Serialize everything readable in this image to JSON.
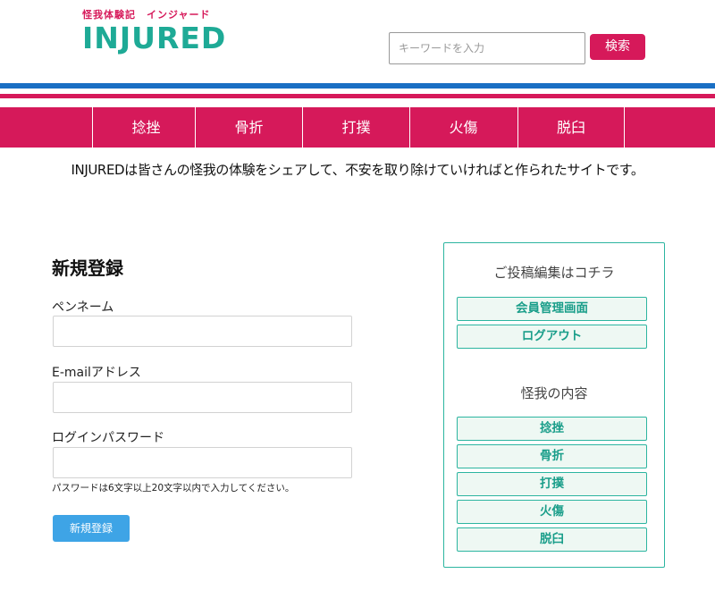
{
  "header": {
    "logo_sub": "怪我体験記　インジャード",
    "logo_main": "INJURED",
    "search_placeholder": "キーワードを入力",
    "search_button": "検索"
  },
  "nav": {
    "items": [
      {
        "label": "捻挫"
      },
      {
        "label": "骨折"
      },
      {
        "label": "打撲"
      },
      {
        "label": "火傷"
      },
      {
        "label": "脱臼"
      }
    ]
  },
  "tagline": "INJUREDは皆さんの怪我の体験をシェアして、不安を取り除けていければと作られたサイトです。",
  "form": {
    "title": "新規登録",
    "fields": [
      {
        "label": "ペンネーム",
        "value": ""
      },
      {
        "label": "E-mailアドレス",
        "value": ""
      },
      {
        "label": "ログインパスワード",
        "value": ""
      }
    ],
    "password_help": "パスワードは6文字以上20文字以内で入力してください。",
    "submit": "新規登録"
  },
  "sidebar": {
    "edit_heading": "ご投稿編集はコチラ",
    "edit_links": [
      {
        "label": "会員管理画面"
      },
      {
        "label": "ログアウト"
      }
    ],
    "category_heading": "怪我の内容",
    "categories": [
      {
        "label": "捻挫"
      },
      {
        "label": "骨折"
      },
      {
        "label": "打撲"
      },
      {
        "label": "火傷"
      },
      {
        "label": "脱臼"
      }
    ]
  },
  "colors": {
    "brand_teal": "#1eaa96",
    "brand_red": "#d6195a",
    "stripe_blue": "#1a6fc4",
    "submit_blue": "#3ea4e6"
  }
}
